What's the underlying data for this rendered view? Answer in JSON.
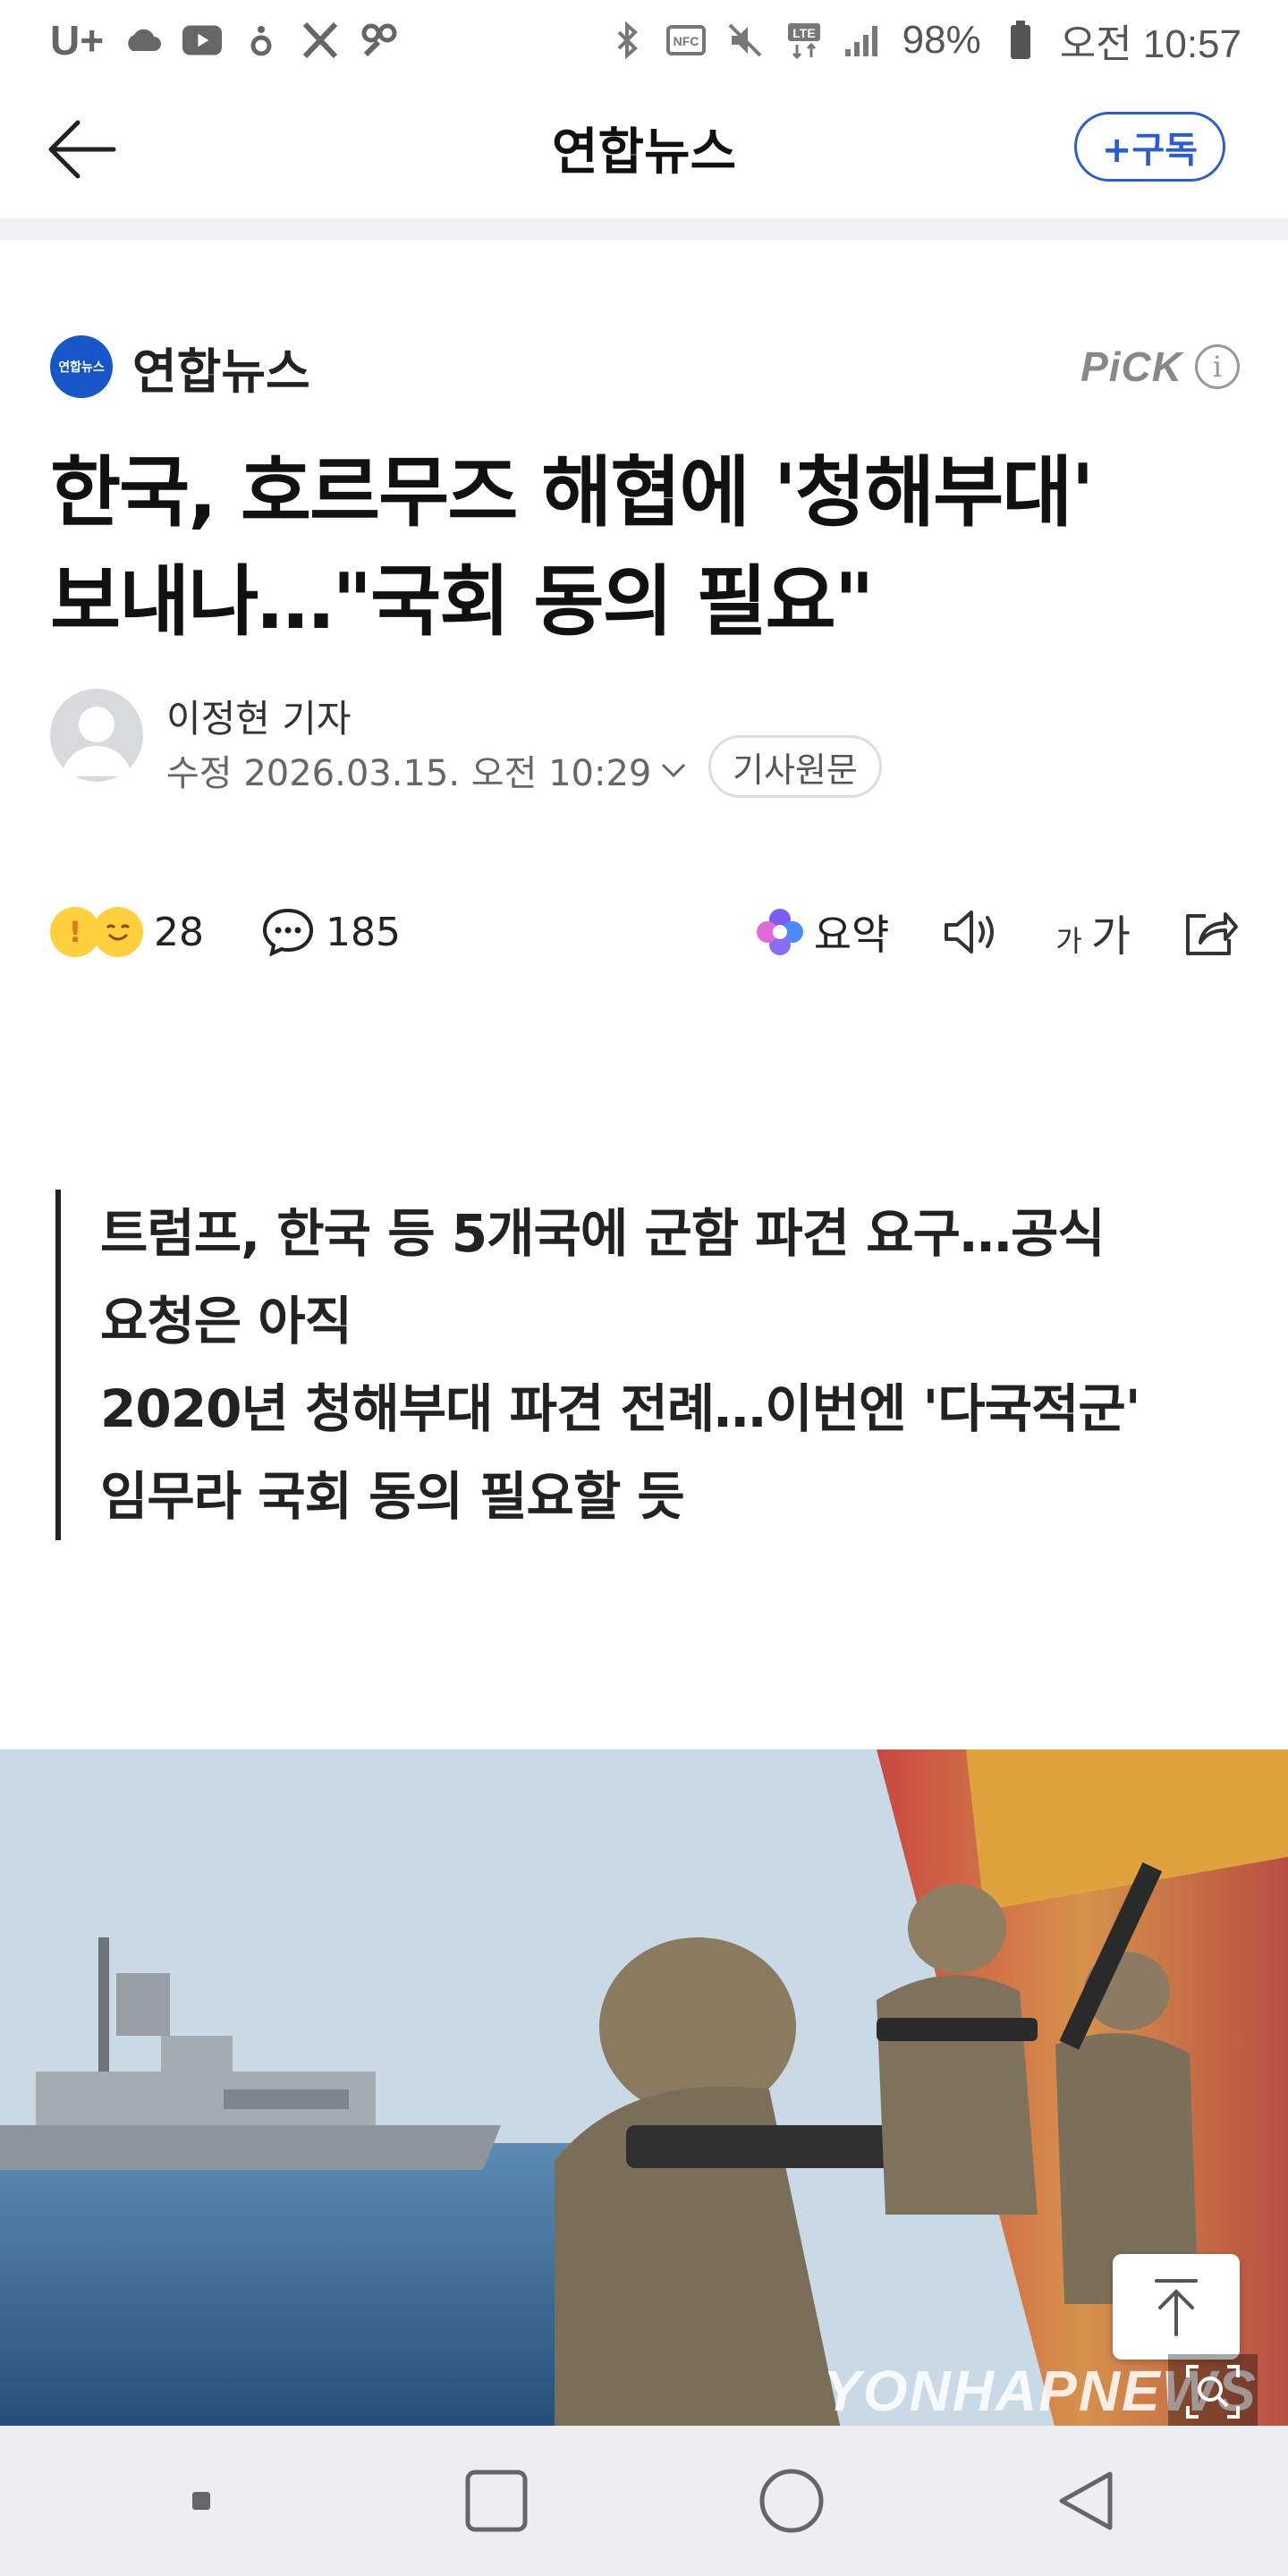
{
  "status_bar": {
    "carrier": "U+",
    "battery": "98%",
    "time": "오전 10:57",
    "icons": [
      "cloud-icon",
      "youtube-icon",
      "dot-icon",
      "x-icon",
      "link-icon",
      "bluetooth-icon",
      "nfc-icon",
      "mute-icon",
      "lte-icon",
      "signal-icon",
      "battery-icon"
    ]
  },
  "header": {
    "title": "연합뉴스",
    "subscribe_label": "+구독",
    "back_icon": "arrow-left-icon"
  },
  "press": {
    "logo_text": "연합뉴스",
    "name": "연합뉴스",
    "pick_label": "PiCK",
    "info_icon": "i"
  },
  "article": {
    "headline_line1": "한국, 호르무즈 해협에 '청해부대'",
    "headline_line2": "보내나…\"국회 동의 필요\"",
    "reporter": "이정현 기자",
    "date": "수정 2026.03.15. 오전 10:29",
    "original_button": "기사원문"
  },
  "actions": {
    "reaction_count": "28",
    "comment_count": "185",
    "summary_label": "요약",
    "fontsize_small": "가",
    "fontsize_big": "가"
  },
  "summary": {
    "line1": "트럼프, 한국 등 5개국에 군함 파견 요구…공식",
    "line2": "요청은 아직",
    "line3": "2020년 청해부대 파견 전례…이번엔 '다국적군'",
    "line4": "임무라 국회 동의 필요할 듯"
  },
  "photo": {
    "watermark": "YONHAPNEWS"
  },
  "colors": {
    "accent": "#2a5cd7",
    "press_logo": "#1656c9",
    "text": "#111111",
    "muted": "#666666"
  }
}
